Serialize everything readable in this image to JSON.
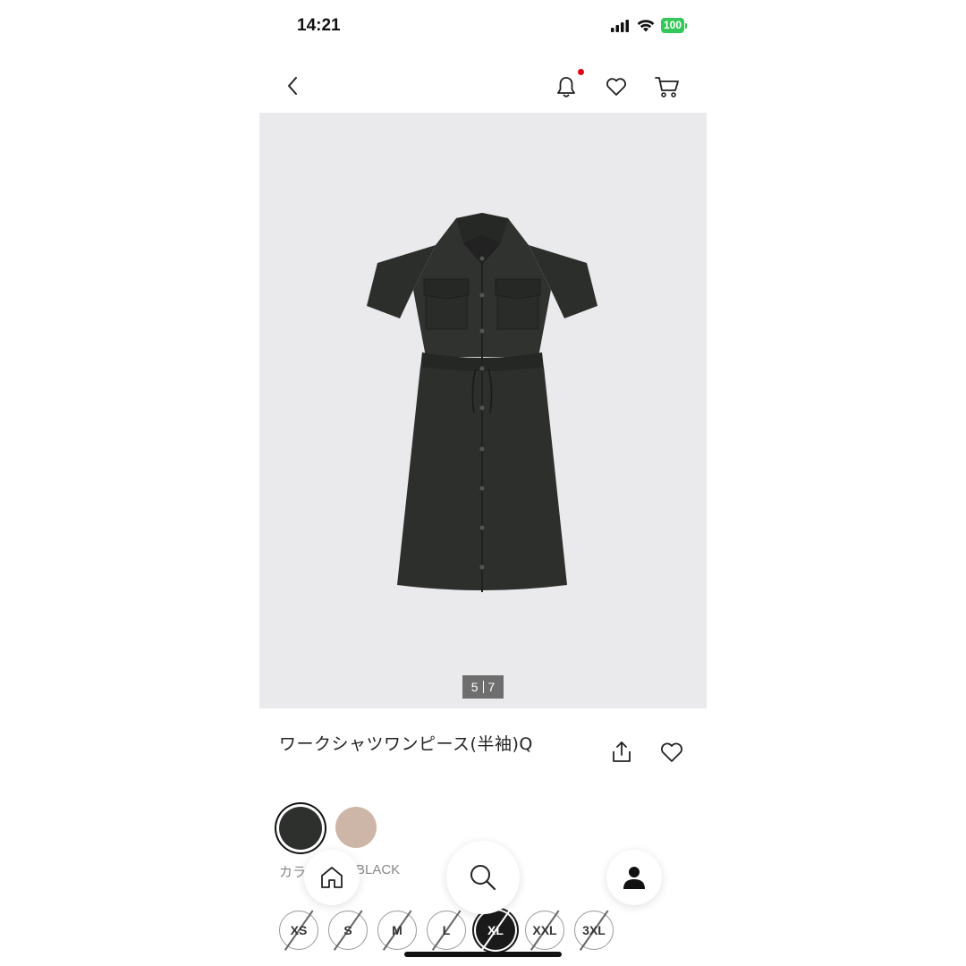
{
  "status_bar": {
    "time": "14:21",
    "battery": "100"
  },
  "product": {
    "title": "ワークシャツワンピース(半袖)Q",
    "image_index": "5",
    "image_total": "7"
  },
  "colors": {
    "label": "カラー",
    "selected_value": "BLACK",
    "swatches": [
      {
        "name": "black",
        "hex": "#2e302e",
        "selected": true
      },
      {
        "name": "beige",
        "hex": "#cdb6a7",
        "selected": false
      }
    ]
  },
  "sizes": [
    {
      "label": "XS",
      "available": false,
      "selected": false
    },
    {
      "label": "S",
      "available": false,
      "selected": false
    },
    {
      "label": "M",
      "available": false,
      "selected": false
    },
    {
      "label": "L",
      "available": false,
      "selected": false
    },
    {
      "label": "XL",
      "available": false,
      "selected": true
    },
    {
      "label": "XXL",
      "available": false,
      "selected": false
    },
    {
      "label": "3XL",
      "available": false,
      "selected": false
    }
  ],
  "icons": {
    "nav": [
      "back-chevron-icon",
      "bell-icon",
      "heart-icon",
      "cart-icon"
    ],
    "actions": [
      "share-icon",
      "heart-icon"
    ],
    "floating": [
      "home-icon",
      "search-icon",
      "user-icon"
    ]
  },
  "colors_theme": {
    "notification_dot": "#e60012",
    "battery": "#34c759",
    "image_bg": "#eaeaec"
  }
}
